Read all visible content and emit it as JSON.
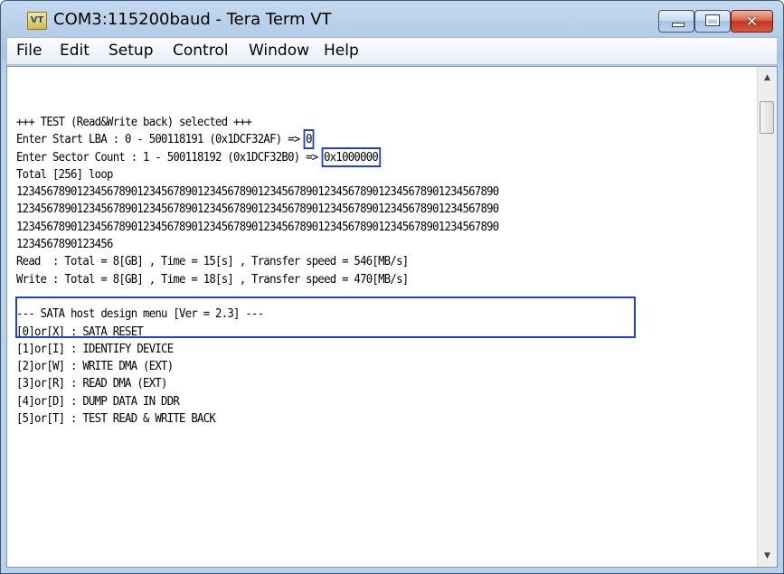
{
  "window": {
    "title": "COM3:115200baud - Tera Term VT",
    "app_icon_text": "VT",
    "close_glyph": "✕"
  },
  "menu": [
    {
      "label": "File"
    },
    {
      "label": "Edit"
    },
    {
      "label": "Setup"
    },
    {
      "label": "Control"
    },
    {
      "label": "Window"
    },
    {
      "label": "Help"
    }
  ],
  "terminal": {
    "lines": [
      {
        "pre": "+++ TEST (Read&Write back) selected +++",
        "hl": "",
        "post": ""
      },
      {
        "pre": "Enter Start LBA : 0 - 500118191 (0x1DCF32AF) => ",
        "hl": "0",
        "post": ""
      },
      {
        "pre": "Enter Sector Count : 1 - 500118192 (0x1DCF32B0) => ",
        "hl": "0x1000000",
        "post": ""
      },
      {
        "pre": "Total [256] loop",
        "hl": "",
        "post": ""
      },
      {
        "pre": "12345678901234567890123456789012345678901234567890123456789012345678901234567890",
        "hl": "",
        "post": ""
      },
      {
        "pre": "12345678901234567890123456789012345678901234567890123456789012345678901234567890",
        "hl": "",
        "post": ""
      },
      {
        "pre": "12345678901234567890123456789012345678901234567890123456789012345678901234567890",
        "hl": "",
        "post": ""
      },
      {
        "pre": "1234567890123456",
        "hl": "",
        "post": ""
      },
      {
        "pre": "Read  : Total = 8[GB] , Time = 15[s] , Transfer speed = 546[MB/s]",
        "hl": "",
        "post": ""
      },
      {
        "pre": "Write : Total = 8[GB] , Time = 18[s] , Transfer speed = 470[MB/s]",
        "hl": "",
        "post": ""
      },
      {
        "pre": "",
        "hl": "",
        "post": ""
      },
      {
        "pre": "--- SATA host design menu [Ver = 2.3] ---",
        "hl": "",
        "post": ""
      },
      {
        "pre": "[0]or[X] : SATA RESET",
        "hl": "",
        "post": ""
      },
      {
        "pre": "[1]or[I] : IDENTIFY DEVICE",
        "hl": "",
        "post": ""
      },
      {
        "pre": "[2]or[W] : WRITE DMA (EXT)",
        "hl": "",
        "post": ""
      },
      {
        "pre": "[3]or[R] : READ DMA (EXT)",
        "hl": "",
        "post": ""
      },
      {
        "pre": "[4]or[D] : DUMP DATA IN DDR",
        "hl": "",
        "post": ""
      },
      {
        "pre": "[5]or[T] : TEST READ & WRITE BACK",
        "hl": "",
        "post": ""
      },
      {
        "pre": "",
        "hl": "",
        "post": ""
      }
    ]
  },
  "scrollbar": {
    "up_glyph": "▲",
    "down_glyph": "▼"
  },
  "colors": {
    "highlight_box": "#1f3fe0",
    "title_bar": "#b7cfe9",
    "close_button": "#c4371c"
  }
}
